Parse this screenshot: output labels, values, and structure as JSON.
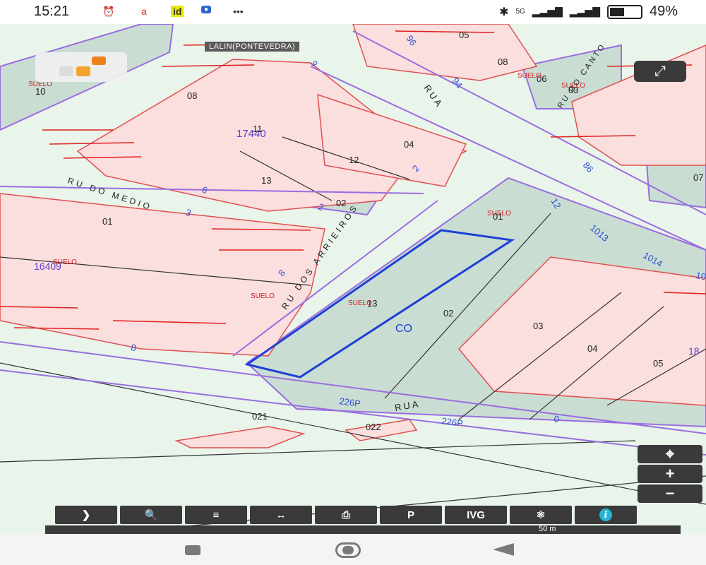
{
  "status_bar": {
    "time": "15:21",
    "network": "5G",
    "battery": "49%"
  },
  "map": {
    "town_label": "LALIN(PONTEVEDRA)",
    "colors": {
      "background": "#e9f4ea",
      "parcel_green": "#c9ddd3",
      "building_pink": "#fbdede",
      "cadastral_line": "#9a6ee0",
      "building_line": "#e05050",
      "selection": "#1f3fd6",
      "annotation": "#d42020"
    },
    "streets": [
      {
        "label": "RUA"
      },
      {
        "label": "RU DO MEDIO"
      },
      {
        "label": "RU DOS ARRIEIROS"
      },
      {
        "label": "RUA"
      },
      {
        "label": "RU DO CANTO"
      }
    ],
    "blocks": [
      {
        "label": "17440"
      },
      {
        "label": "16409"
      },
      {
        "label": "18"
      }
    ],
    "parcels": [
      {
        "label": "10"
      },
      {
        "label": "08"
      },
      {
        "label": "11"
      },
      {
        "label": "04"
      },
      {
        "label": "12"
      },
      {
        "label": "13"
      },
      {
        "label": "02"
      },
      {
        "label": "01"
      },
      {
        "label": "01"
      },
      {
        "label": "13"
      },
      {
        "label": "02"
      },
      {
        "label": "03"
      },
      {
        "label": "04"
      },
      {
        "label": "05"
      },
      {
        "label": "021"
      },
      {
        "label": "022"
      },
      {
        "label": "05"
      },
      {
        "label": "08"
      },
      {
        "label": "06"
      },
      {
        "label": "03"
      },
      {
        "label": "07"
      }
    ],
    "suelo_labels": [
      "SUELO",
      "SUELO",
      "SUELO",
      "SUELO",
      "SUELO",
      "SUELO",
      "SUELO"
    ],
    "selection_label": "CO",
    "street_numbers": [
      "94",
      "12",
      "1013",
      "1014",
      "86",
      "9",
      "6",
      "3",
      "8",
      "2",
      "226P",
      "226P",
      "8",
      "10",
      "0",
      "96",
      "2"
    ]
  },
  "controls": {
    "toolbar": [
      {
        "label": "❯",
        "name": "expand-menu-button"
      },
      {
        "label": "🔍",
        "name": "search-button"
      },
      {
        "label": "≡",
        "name": "layers-button"
      },
      {
        "label": "↔",
        "name": "measure-distance-button"
      },
      {
        "label": "⎙",
        "name": "print-button"
      },
      {
        "label": "P",
        "name": "parking-button"
      },
      {
        "label": "IVG",
        "name": "ivg-button"
      },
      {
        "label": "⚛",
        "name": "share-button"
      },
      {
        "label": "i",
        "name": "info-button"
      }
    ],
    "zoom_in": "+",
    "zoom_out": "−",
    "locate": "⌖",
    "fullscreen": "⤢",
    "scale": "50 m"
  }
}
